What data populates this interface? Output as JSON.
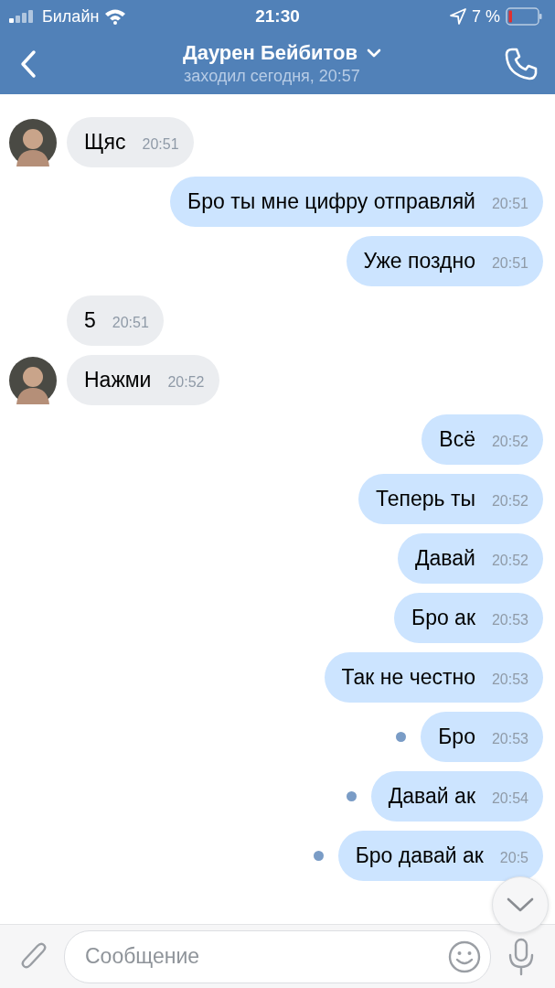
{
  "status_bar": {
    "carrier": "Билайн",
    "time": "21:30",
    "battery": "7 %"
  },
  "header": {
    "title": "Даурен Бейбитов",
    "subtitle": "заходил сегодня, 20:57"
  },
  "messages": [
    {
      "kind": "incoming",
      "text": "Щяс",
      "time": "20:51",
      "avatar": true,
      "unread": false
    },
    {
      "kind": "outgoing",
      "text": "Бро ты мне цифру отправляй",
      "time": "20:51",
      "avatar": false,
      "unread": false
    },
    {
      "kind": "outgoing",
      "text": "Уже поздно",
      "time": "20:51",
      "avatar": false,
      "unread": false
    },
    {
      "kind": "incoming",
      "text": "5",
      "time": "20:51",
      "avatar": false,
      "unread": false
    },
    {
      "kind": "incoming",
      "text": "Нажми",
      "time": "20:52",
      "avatar": true,
      "unread": false
    },
    {
      "kind": "outgoing",
      "text": "Всё",
      "time": "20:52",
      "avatar": false,
      "unread": false
    },
    {
      "kind": "outgoing",
      "text": "Теперь ты",
      "time": "20:52",
      "avatar": false,
      "unread": false
    },
    {
      "kind": "outgoing",
      "text": "Давай",
      "time": "20:52",
      "avatar": false,
      "unread": false
    },
    {
      "kind": "outgoing",
      "text": "Бро ак",
      "time": "20:53",
      "avatar": false,
      "unread": false
    },
    {
      "kind": "outgoing",
      "text": "Так не честно",
      "time": "20:53",
      "avatar": false,
      "unread": false
    },
    {
      "kind": "outgoing",
      "text": "Бро",
      "time": "20:53",
      "avatar": false,
      "unread": true
    },
    {
      "kind": "outgoing",
      "text": "Давай ак",
      "time": "20:54",
      "avatar": false,
      "unread": true
    },
    {
      "kind": "outgoing",
      "text": "Бро давай ак",
      "time": "20:5",
      "avatar": false,
      "unread": true
    }
  ],
  "composer": {
    "placeholder": "Сообщение"
  }
}
